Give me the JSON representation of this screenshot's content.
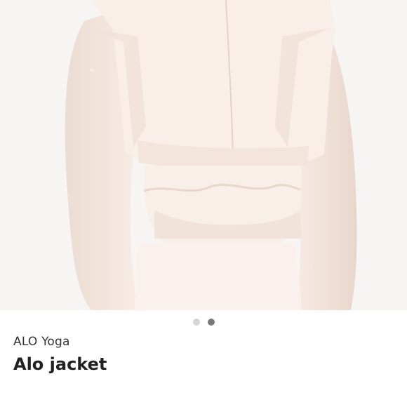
{
  "listing": {
    "brand": "ALO Yoga",
    "title": "Alo jacket",
    "image_icon": "product-photo",
    "carousel": {
      "count": 2,
      "active_index": 1
    }
  },
  "colors": {
    "garment": "#f6e9e1",
    "background": "#f7f5f3",
    "dot_inactive": "#d6d6d6",
    "dot_active": "#7a7a7a"
  }
}
